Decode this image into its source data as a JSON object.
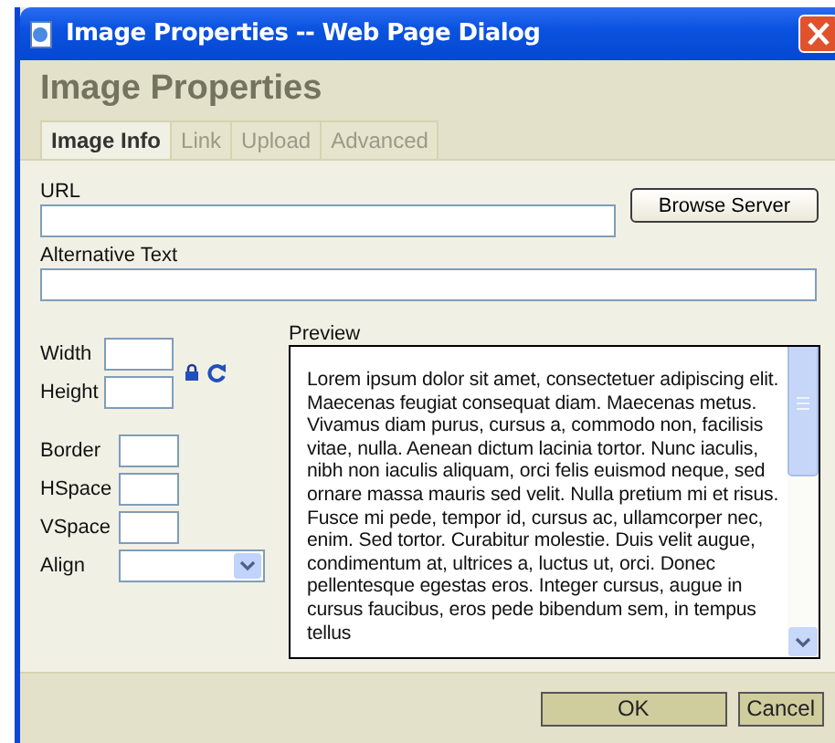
{
  "window": {
    "title": "Image Properties -- Web Page Dialog"
  },
  "heading": "Image Properties",
  "tabs": [
    {
      "label": "Image Info",
      "selected": true
    },
    {
      "label": "Link",
      "selected": false
    },
    {
      "label": "Upload",
      "selected": false
    },
    {
      "label": "Advanced",
      "selected": false
    }
  ],
  "url_field": {
    "label": "URL"
  },
  "browse_button": "Browse Server",
  "alt_text_field": {
    "label": "Alternative Text"
  },
  "dimension_fields": [
    {
      "label": "Width"
    },
    {
      "label": "Height"
    }
  ],
  "spacing_fields": [
    {
      "label": "Border"
    },
    {
      "label": "HSpace"
    },
    {
      "label": "VSpace"
    }
  ],
  "align_field": {
    "label": "Align"
  },
  "preview": {
    "label": "Preview",
    "text": "Lorem ipsum dolor sit amet, consectetuer adipiscing elit. Maecenas feugiat consequat diam. Maecenas metus. Vivamus diam purus, cursus a, commodo non, facilisis vitae, nulla. Aenean dictum lacinia tortor. Nunc iaculis, nibh non iaculis aliquam, orci felis euismod neque, sed ornare massa mauris sed velit. Nulla pretium mi et risus. Fusce mi pede, tempor id, cursus ac, ullamcorper nec, enim. Sed tortor. Curabitur molestie. Duis velit augue, condimentum at, ultrices a, luctus ut, orci. Donec pellentesque egestas eros. Integer cursus, augue in cursus faucibus, eros pede bibendum sem, in tempus tellus"
  },
  "buttons": [
    "OK",
    "Cancel"
  ]
}
